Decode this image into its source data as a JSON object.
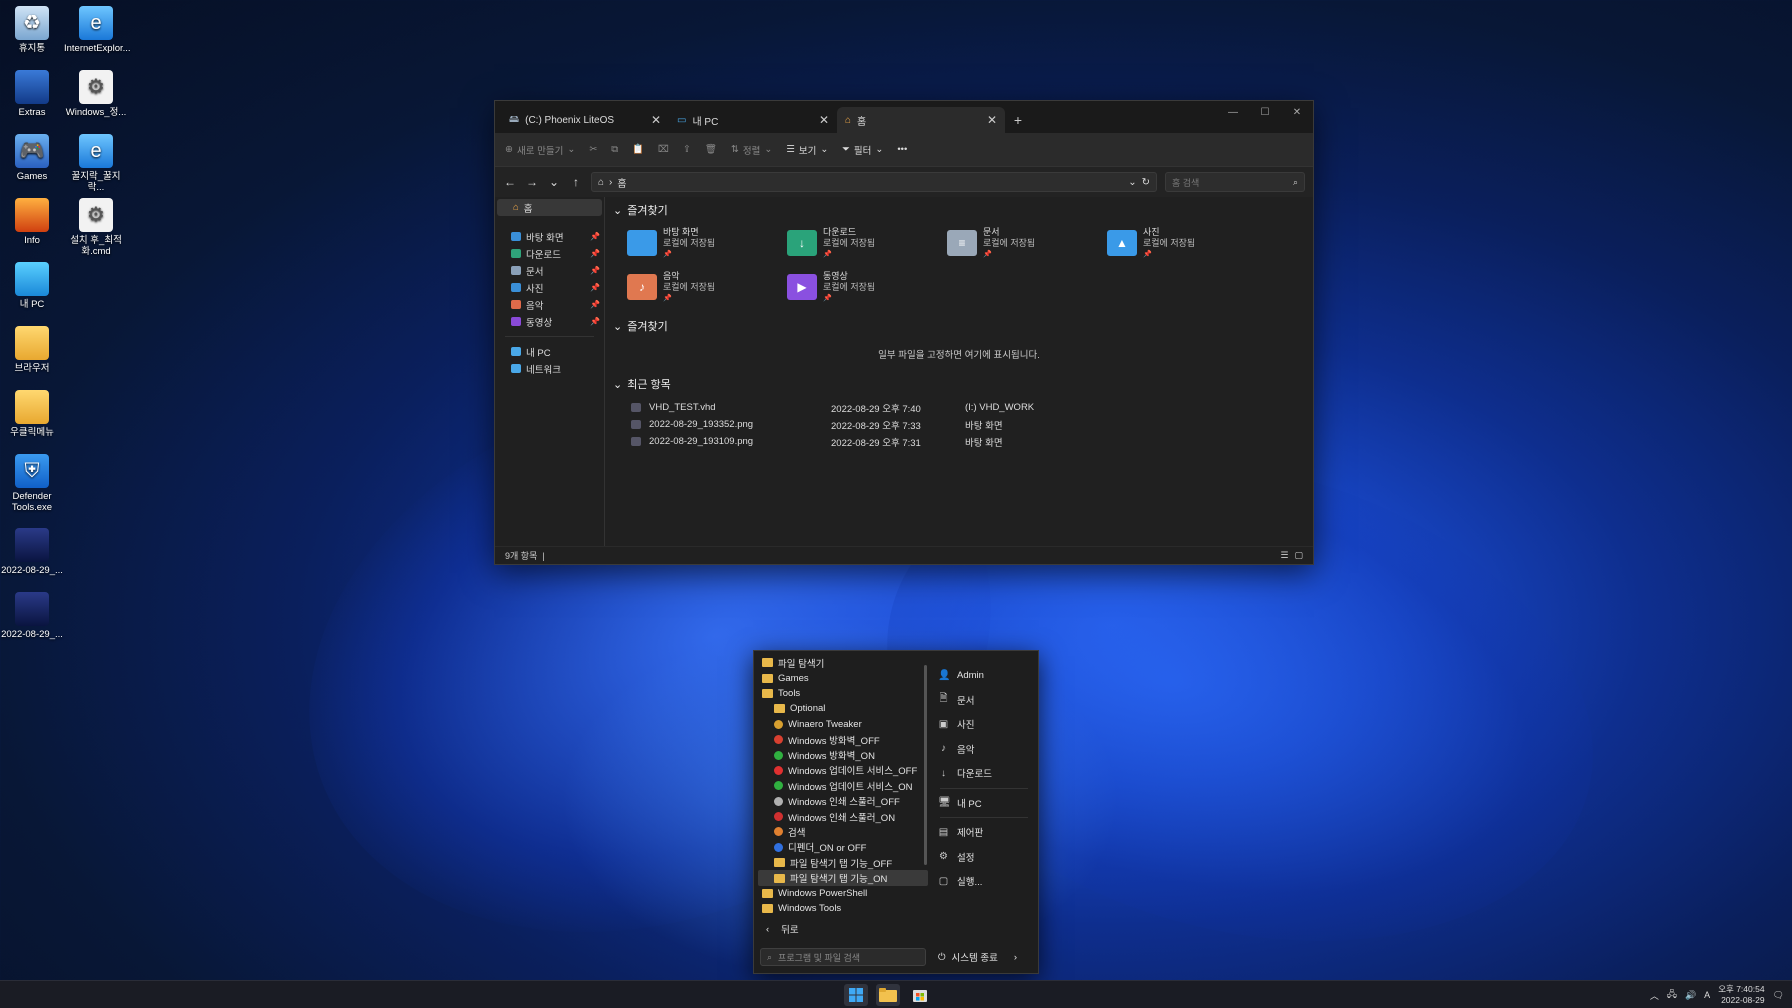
{
  "desktop": {
    "icons": [
      {
        "label": "휴지통",
        "icon": "recycle-bin-icon"
      },
      {
        "label": "InternetExplor...",
        "icon": "internet-explorer-icon"
      },
      {
        "label": "Extras",
        "icon": "extras-icon"
      },
      {
        "label": "Windows_정...",
        "icon": "gear-file-icon"
      },
      {
        "label": "Games",
        "icon": "gamepad-icon"
      },
      {
        "label": "꿀지락_꿀지락...",
        "icon": "internet-explorer-icon"
      },
      {
        "label": "Info",
        "icon": "phoenix-icon"
      },
      {
        "label": "설치 후_최적화.cmd",
        "icon": "gear-file-icon"
      },
      {
        "label": "내 PC",
        "icon": "monitor-icon"
      },
      {
        "label": "브라우저",
        "icon": "folder-icon"
      },
      {
        "label": "우클릭메뉴",
        "icon": "folder-icon"
      },
      {
        "label": "Defender Tools.exe",
        "icon": "shield-icon"
      },
      {
        "label": "2022-08-29_...",
        "icon": "image-file-icon"
      },
      {
        "label": "2022-08-29_...",
        "icon": "image-file-icon"
      }
    ]
  },
  "explorer": {
    "tabs": [
      {
        "label": "(C:) Phoenix LiteOS"
      },
      {
        "label": "내 PC"
      },
      {
        "label": "홈"
      }
    ],
    "toolbar": {
      "new_label": "새로 만들기",
      "sort_label": "정렬",
      "view_label": "보기",
      "filter_label": "필터"
    },
    "address": {
      "path": "홈"
    },
    "search": {
      "placeholder": "홈 검색"
    },
    "nav": {
      "home": "홈",
      "quick": [
        {
          "label": "바탕 화면",
          "color": "#3a8fd8"
        },
        {
          "label": "다운로드",
          "color": "#2fa37a"
        },
        {
          "label": "문서",
          "color": "#8aa0b8"
        },
        {
          "label": "사진",
          "color": "#3a8fd8"
        },
        {
          "label": "음악",
          "color": "#e06a4a"
        },
        {
          "label": "동영상",
          "color": "#8a4ad8"
        }
      ],
      "thispc": "내 PC",
      "network": "네트워크"
    },
    "sections": {
      "favorites": "즐겨찾기",
      "favorites2": "즐겨찾기",
      "recent": "최근 항목",
      "empty_msg": "일부 파일을 고정하면 여기에 표시됩니다."
    },
    "folders": [
      {
        "name": "바탕 화면",
        "sub": "로컬에 저장됨",
        "color": "#3a9ae8",
        "glyph": ""
      },
      {
        "name": "다운로드",
        "sub": "로컬에 저장됨",
        "color": "#2aa37a",
        "glyph": "↓"
      },
      {
        "name": "문서",
        "sub": "로컬에 저장됨",
        "color": "#9aa8b8",
        "glyph": "≡"
      },
      {
        "name": "사진",
        "sub": "로컬에 저장됨",
        "color": "#3a9ae8",
        "glyph": "▲"
      },
      {
        "name": "음악",
        "sub": "로컬에 저장됨",
        "color": "#e07850",
        "glyph": "♪"
      },
      {
        "name": "동영상",
        "sub": "로컬에 저장됨",
        "color": "#8a50e0",
        "glyph": "▶"
      }
    ],
    "recent": [
      {
        "name": "VHD_TEST.vhd",
        "date": "2022-08-29 오후 7:40",
        "loc": "(I:) VHD_WORK"
      },
      {
        "name": "2022-08-29_193352.png",
        "date": "2022-08-29 오후 7:33",
        "loc": "바탕 화면"
      },
      {
        "name": "2022-08-29_193109.png",
        "date": "2022-08-29 오후 7:31",
        "loc": "바탕 화면"
      }
    ],
    "status": "9개 항목"
  },
  "startmenu": {
    "programs": [
      {
        "label": "파일 탐색기",
        "kind": "folder",
        "indent": false
      },
      {
        "label": "Games",
        "kind": "folder",
        "indent": false
      },
      {
        "label": "Tools",
        "kind": "folder",
        "indent": false
      },
      {
        "label": "Optional",
        "kind": "folder",
        "indent": true
      },
      {
        "label": "Winaero Tweaker",
        "kind": "dot",
        "color": "#d8a030",
        "indent": true
      },
      {
        "label": "Windows 방화벽_OFF",
        "kind": "dot",
        "color": "#d84030",
        "indent": true
      },
      {
        "label": "Windows 방화벽_ON",
        "kind": "dot",
        "color": "#30b040",
        "indent": true
      },
      {
        "label": "Windows 업데이트 서비스_OFF",
        "kind": "dot",
        "color": "#e03030",
        "indent": true
      },
      {
        "label": "Windows 업데이트 서비스_ON",
        "kind": "dot",
        "color": "#30b040",
        "indent": true
      },
      {
        "label": "Windows 인쇄 스풀러_OFF",
        "kind": "dot",
        "color": "#b0b0b0",
        "indent": true
      },
      {
        "label": "Windows 인쇄 스풀러_ON",
        "kind": "dot",
        "color": "#d03030",
        "indent": true
      },
      {
        "label": "검색",
        "kind": "dot",
        "color": "#e08030",
        "indent": true
      },
      {
        "label": "디펜더_ON or OFF",
        "kind": "dot",
        "color": "#3070e0",
        "indent": true
      },
      {
        "label": "파일 탐색기 탭 기능_OFF",
        "kind": "folder",
        "indent": true
      },
      {
        "label": "파일 탐색기 탭 기능_ON",
        "kind": "folder",
        "indent": true
      },
      {
        "label": "Windows PowerShell",
        "kind": "folder",
        "indent": false
      },
      {
        "label": "Windows Tools",
        "kind": "folder",
        "indent": false
      }
    ],
    "places": [
      {
        "label": "Admin",
        "icon": "user-icon",
        "glyph": "👤"
      },
      {
        "label": "문서",
        "icon": "document-icon",
        "glyph": "🗎"
      },
      {
        "label": "사진",
        "icon": "picture-icon",
        "glyph": "▣"
      },
      {
        "label": "음악",
        "icon": "music-icon",
        "glyph": "♪"
      },
      {
        "label": "다운로드",
        "icon": "download-icon",
        "glyph": "↓"
      },
      {
        "label": "내 PC",
        "icon": "computer-icon",
        "glyph": "🖥"
      },
      {
        "label": "제어판",
        "icon": "control-panel-icon",
        "glyph": "▤"
      },
      {
        "label": "설정",
        "icon": "gear-icon",
        "glyph": "⚙"
      },
      {
        "label": "실행...",
        "icon": "run-icon",
        "glyph": "▢"
      }
    ],
    "back_label": "뒤로",
    "search_placeholder": "프로그램 및 파일 검색",
    "shutdown_label": "시스템 종료"
  },
  "taskbar": {
    "time": "오후 7:40:54",
    "date": "2022-08-29",
    "ime": "A"
  }
}
